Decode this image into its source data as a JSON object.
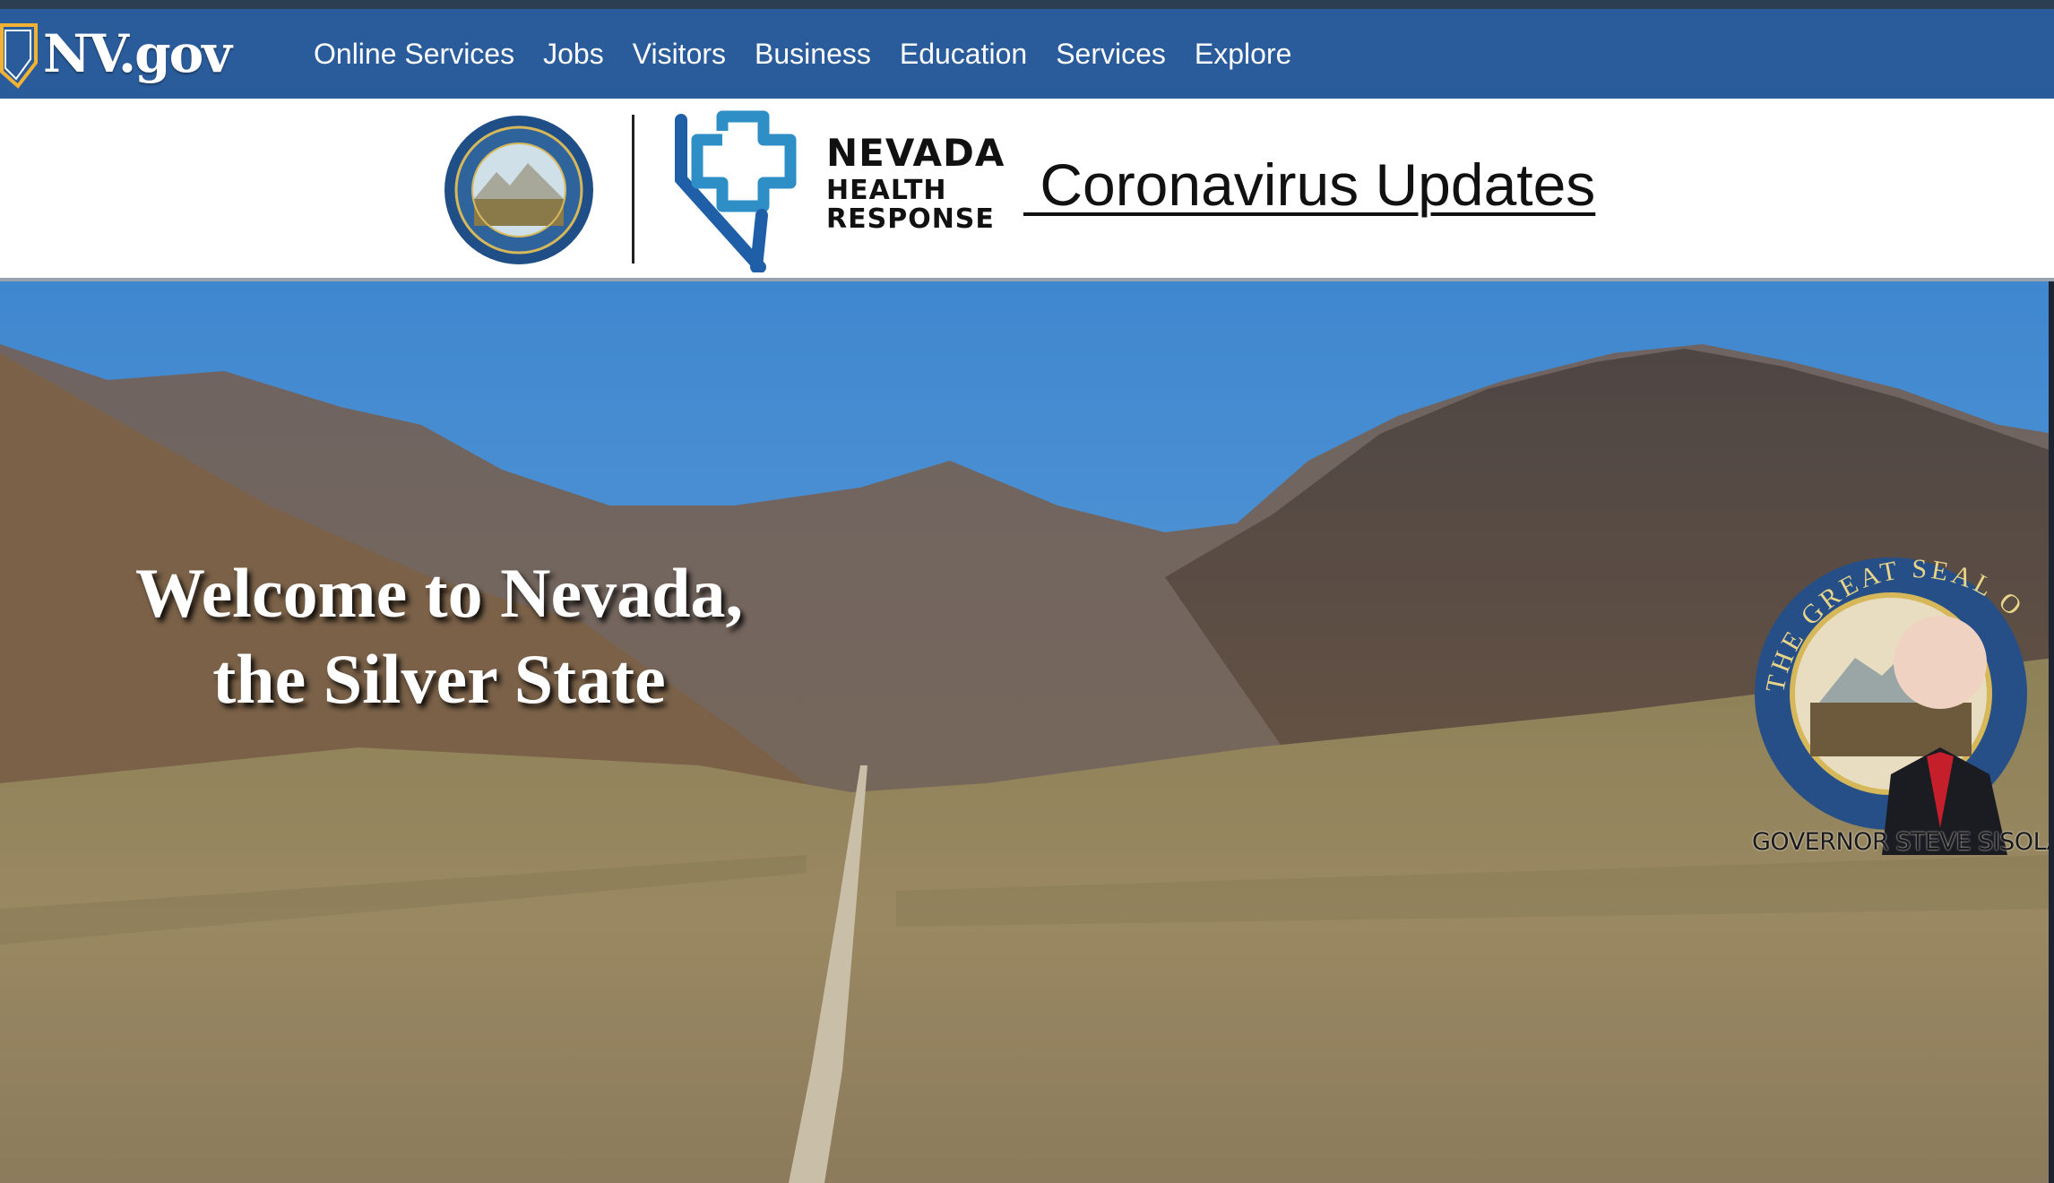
{
  "site": {
    "logo_text": "NV.gov",
    "brand_color": "#2a5c9b"
  },
  "nav": {
    "items": [
      {
        "label": "Online Services"
      },
      {
        "label": "Jobs"
      },
      {
        "label": "Visitors"
      },
      {
        "label": "Business"
      },
      {
        "label": "Education"
      },
      {
        "label": "Services"
      },
      {
        "label": "Explore"
      }
    ]
  },
  "banner": {
    "nhr_line1": "NEVADA",
    "nhr_line2": "HEALTH",
    "nhr_line3": "RESPONSE",
    "covid_link": " Coronavirus Updates",
    "accent_color": "#2e8ec6"
  },
  "hero": {
    "headline_line1": "Welcome to Nevada,",
    "headline_line2": "the Silver State",
    "governor_caption": "GOVERNOR STEVE SISOLAK",
    "seal_text": "THE GREAT SEAL OF THE"
  }
}
